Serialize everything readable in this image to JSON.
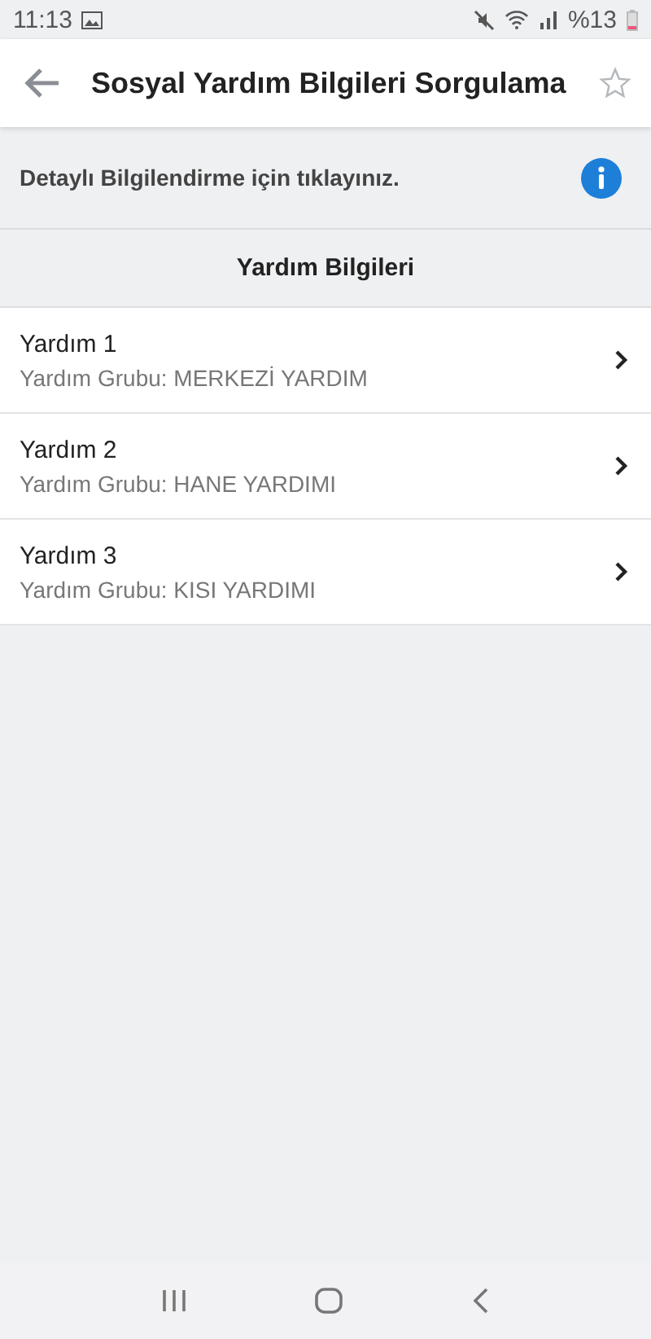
{
  "status_bar": {
    "time": "11:13",
    "battery": "%13"
  },
  "header": {
    "title": "Sosyal Yardım Bilgileri Sorgulama",
    "favorite": false
  },
  "info_banner": {
    "text": "Detaylı Bilgilendirme için tıklayınız."
  },
  "section": {
    "title": "Yardım Bilgileri"
  },
  "items": [
    {
      "title": "Yardım 1",
      "subtitle": "Yardım Grubu: MERKEZİ YARDIM"
    },
    {
      "title": "Yardım 2",
      "subtitle": "Yardım Grubu: HANE YARDIMI"
    },
    {
      "title": "Yardım 3",
      "subtitle": "Yardım Grubu: KISI YARDIMI"
    }
  ]
}
